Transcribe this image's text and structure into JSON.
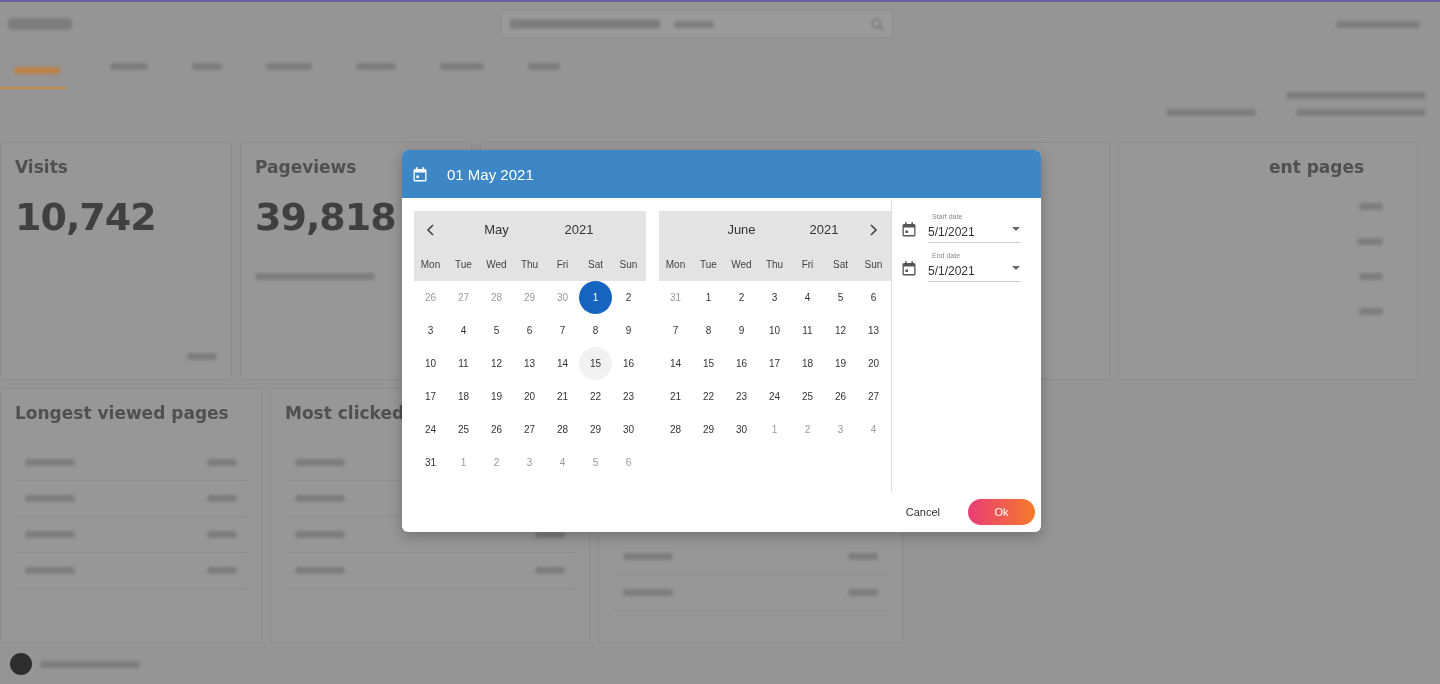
{
  "dashboard": {
    "stats": [
      {
        "title": "Visits",
        "value": "10,742"
      },
      {
        "title": "Pageviews",
        "value": "39,818"
      }
    ],
    "partial_card": {
      "title": "ent pages"
    },
    "panels": [
      {
        "title": "Longest viewed pages"
      },
      {
        "title": "Most clicked"
      }
    ]
  },
  "dialog": {
    "header": {
      "date": "01 May 2021"
    },
    "months": [
      {
        "prev_arrow": true,
        "next_arrow": false,
        "month": "May",
        "year": "2021",
        "weekdays": [
          "Mon",
          "Tue",
          "Wed",
          "Thu",
          "Fri",
          "Sat",
          "Sun"
        ],
        "weeks": [
          [
            {
              "day": "26",
              "outside": true,
              "selected": false,
              "hovered": false
            },
            {
              "day": "27",
              "outside": true,
              "selected": false,
              "hovered": false
            },
            {
              "day": "28",
              "outside": true,
              "selected": false,
              "hovered": false
            },
            {
              "day": "29",
              "outside": true,
              "selected": false,
              "hovered": false
            },
            {
              "day": "30",
              "outside": true,
              "selected": false,
              "hovered": false
            },
            {
              "day": "1",
              "outside": false,
              "selected": true,
              "hovered": false
            },
            {
              "day": "2",
              "outside": false,
              "selected": false,
              "hovered": false
            }
          ],
          [
            {
              "day": "3",
              "outside": false,
              "selected": false,
              "hovered": false
            },
            {
              "day": "4",
              "outside": false,
              "selected": false,
              "hovered": false
            },
            {
              "day": "5",
              "outside": false,
              "selected": false,
              "hovered": false
            },
            {
              "day": "6",
              "outside": false,
              "selected": false,
              "hovered": false
            },
            {
              "day": "7",
              "outside": false,
              "selected": false,
              "hovered": false
            },
            {
              "day": "8",
              "outside": false,
              "selected": false,
              "hovered": false
            },
            {
              "day": "9",
              "outside": false,
              "selected": false,
              "hovered": false
            }
          ],
          [
            {
              "day": "10",
              "outside": false,
              "selected": false,
              "hovered": false
            },
            {
              "day": "11",
              "outside": false,
              "selected": false,
              "hovered": false
            },
            {
              "day": "12",
              "outside": false,
              "selected": false,
              "hovered": false
            },
            {
              "day": "13",
              "outside": false,
              "selected": false,
              "hovered": false
            },
            {
              "day": "14",
              "outside": false,
              "selected": false,
              "hovered": false
            },
            {
              "day": "15",
              "outside": false,
              "selected": false,
              "hovered": true
            },
            {
              "day": "16",
              "outside": false,
              "selected": false,
              "hovered": false
            }
          ],
          [
            {
              "day": "17",
              "outside": false,
              "selected": false,
              "hovered": false
            },
            {
              "day": "18",
              "outside": false,
              "selected": false,
              "hovered": false
            },
            {
              "day": "19",
              "outside": false,
              "selected": false,
              "hovered": false
            },
            {
              "day": "20",
              "outside": false,
              "selected": false,
              "hovered": false
            },
            {
              "day": "21",
              "outside": false,
              "selected": false,
              "hovered": false
            },
            {
              "day": "22",
              "outside": false,
              "selected": false,
              "hovered": false
            },
            {
              "day": "23",
              "outside": false,
              "selected": false,
              "hovered": false
            }
          ],
          [
            {
              "day": "24",
              "outside": false,
              "selected": false,
              "hovered": false
            },
            {
              "day": "25",
              "outside": false,
              "selected": false,
              "hovered": false
            },
            {
              "day": "26",
              "outside": false,
              "selected": false,
              "hovered": false
            },
            {
              "day": "27",
              "outside": false,
              "selected": false,
              "hovered": false
            },
            {
              "day": "28",
              "outside": false,
              "selected": false,
              "hovered": false
            },
            {
              "day": "29",
              "outside": false,
              "selected": false,
              "hovered": false
            },
            {
              "day": "30",
              "outside": false,
              "selected": false,
              "hovered": false
            }
          ],
          [
            {
              "day": "31",
              "outside": false,
              "selected": false,
              "hovered": false
            },
            {
              "day": "1",
              "outside": true,
              "selected": false,
              "hovered": false
            },
            {
              "day": "2",
              "outside": true,
              "selected": false,
              "hovered": false
            },
            {
              "day": "3",
              "outside": true,
              "selected": false,
              "hovered": false
            },
            {
              "day": "4",
              "outside": true,
              "selected": false,
              "hovered": false
            },
            {
              "day": "5",
              "outside": true,
              "selected": false,
              "hovered": false
            },
            {
              "day": "6",
              "outside": true,
              "selected": false,
              "hovered": false
            }
          ]
        ]
      },
      {
        "prev_arrow": false,
        "next_arrow": true,
        "month": "June",
        "year": "2021",
        "weekdays": [
          "Mon",
          "Tue",
          "Wed",
          "Thu",
          "Fri",
          "Sat",
          "Sun"
        ],
        "weeks": [
          [
            {
              "day": "31",
              "outside": true,
              "selected": false,
              "hovered": false
            },
            {
              "day": "1",
              "outside": false,
              "selected": false,
              "hovered": false
            },
            {
              "day": "2",
              "outside": false,
              "selected": false,
              "hovered": false
            },
            {
              "day": "3",
              "outside": false,
              "selected": false,
              "hovered": false
            },
            {
              "day": "4",
              "outside": false,
              "selected": false,
              "hovered": false
            },
            {
              "day": "5",
              "outside": false,
              "selected": false,
              "hovered": false
            },
            {
              "day": "6",
              "outside": false,
              "selected": false,
              "hovered": false
            }
          ],
          [
            {
              "day": "7",
              "outside": false,
              "selected": false,
              "hovered": false
            },
            {
              "day": "8",
              "outside": false,
              "selected": false,
              "hovered": false
            },
            {
              "day": "9",
              "outside": false,
              "selected": false,
              "hovered": false
            },
            {
              "day": "10",
              "outside": false,
              "selected": false,
              "hovered": false
            },
            {
              "day": "11",
              "outside": false,
              "selected": false,
              "hovered": false
            },
            {
              "day": "12",
              "outside": false,
              "selected": false,
              "hovered": false
            },
            {
              "day": "13",
              "outside": false,
              "selected": false,
              "hovered": false
            }
          ],
          [
            {
              "day": "14",
              "outside": false,
              "selected": false,
              "hovered": false
            },
            {
              "day": "15",
              "outside": false,
              "selected": false,
              "hovered": false
            },
            {
              "day": "16",
              "outside": false,
              "selected": false,
              "hovered": false
            },
            {
              "day": "17",
              "outside": false,
              "selected": false,
              "hovered": false
            },
            {
              "day": "18",
              "outside": false,
              "selected": false,
              "hovered": false
            },
            {
              "day": "19",
              "outside": false,
              "selected": false,
              "hovered": false
            },
            {
              "day": "20",
              "outside": false,
              "selected": false,
              "hovered": false
            }
          ],
          [
            {
              "day": "21",
              "outside": false,
              "selected": false,
              "hovered": false
            },
            {
              "day": "22",
              "outside": false,
              "selected": false,
              "hovered": false
            },
            {
              "day": "23",
              "outside": false,
              "selected": false,
              "hovered": false
            },
            {
              "day": "24",
              "outside": false,
              "selected": false,
              "hovered": false
            },
            {
              "day": "25",
              "outside": false,
              "selected": false,
              "hovered": false
            },
            {
              "day": "26",
              "outside": false,
              "selected": false,
              "hovered": false
            },
            {
              "day": "27",
              "outside": false,
              "selected": false,
              "hovered": false
            }
          ],
          [
            {
              "day": "28",
              "outside": false,
              "selected": false,
              "hovered": false
            },
            {
              "day": "29",
              "outside": false,
              "selected": false,
              "hovered": false
            },
            {
              "day": "30",
              "outside": false,
              "selected": false,
              "hovered": false
            },
            {
              "day": "1",
              "outside": true,
              "selected": false,
              "hovered": false
            },
            {
              "day": "2",
              "outside": true,
              "selected": false,
              "hovered": false
            },
            {
              "day": "3",
              "outside": true,
              "selected": false,
              "hovered": false
            },
            {
              "day": "4",
              "outside": true,
              "selected": false,
              "hovered": false
            }
          ]
        ]
      }
    ],
    "fields": [
      {
        "label": "Start date",
        "value": "5/1/2021"
      },
      {
        "label": "End date",
        "value": "5/1/2021"
      }
    ],
    "buttons": [
      {
        "label": "Cancel",
        "kind": "text"
      },
      {
        "label": "Ok",
        "kind": "primary"
      }
    ]
  }
}
